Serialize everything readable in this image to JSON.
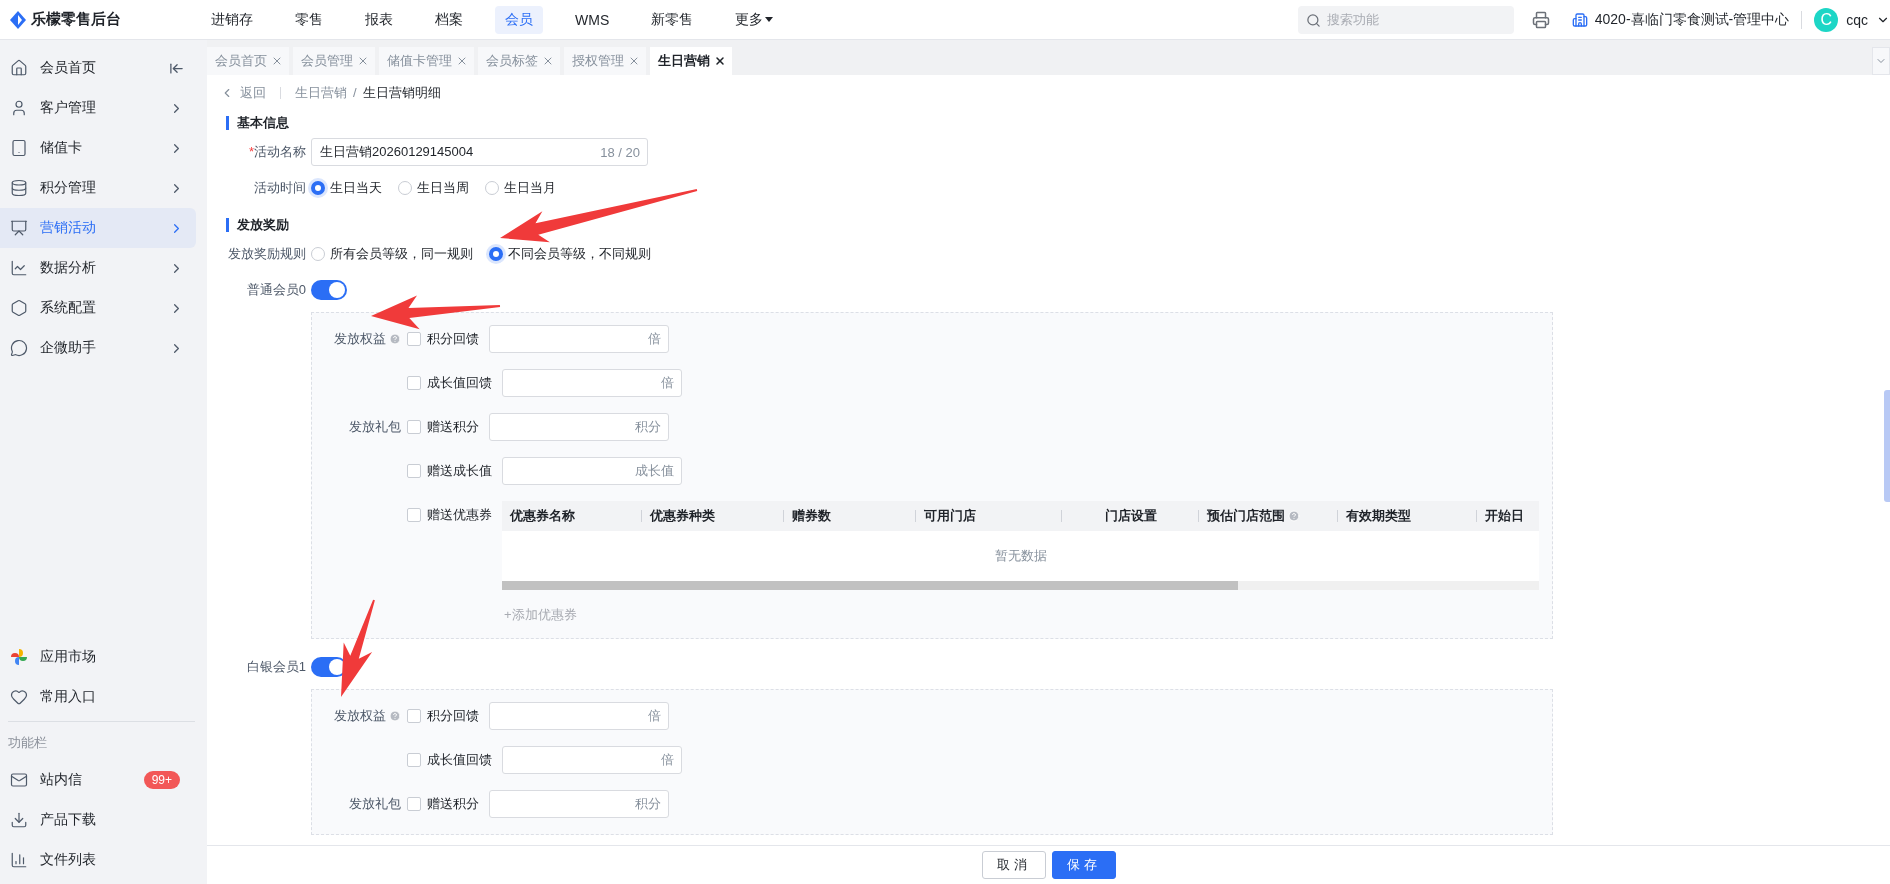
{
  "app": {
    "title": "乐檬零售后台"
  },
  "top_nav": [
    {
      "label": "进销存",
      "selected": false,
      "dropdown": false
    },
    {
      "label": "零售",
      "selected": false,
      "dropdown": false
    },
    {
      "label": "报表",
      "selected": false,
      "dropdown": false
    },
    {
      "label": "档案",
      "selected": false,
      "dropdown": false
    },
    {
      "label": "会员",
      "selected": true,
      "dropdown": false
    },
    {
      "label": "WMS",
      "selected": false,
      "dropdown": false
    },
    {
      "label": "新零售",
      "selected": false,
      "dropdown": false
    },
    {
      "label": "更多",
      "selected": false,
      "dropdown": true
    }
  ],
  "search": {
    "placeholder": "搜索功能"
  },
  "store": "4020-喜临门零食测试-管理中心",
  "user": {
    "initial": "C",
    "name": "cqc"
  },
  "sidebar": {
    "items": [
      {
        "label": "会员首页",
        "selected": false
      },
      {
        "label": "客户管理",
        "selected": false
      },
      {
        "label": "储值卡",
        "selected": false
      },
      {
        "label": "积分管理",
        "selected": false
      },
      {
        "label": "营销活动",
        "selected": true
      },
      {
        "label": "数据分析",
        "selected": false
      },
      {
        "label": "系统配置",
        "selected": false
      },
      {
        "label": "企微助手",
        "selected": false
      }
    ],
    "shortcuts": [
      {
        "label": "应用市场"
      },
      {
        "label": "常用入口"
      }
    ],
    "section_title": "功能栏",
    "tools": [
      {
        "label": "站内信",
        "badge": "99+"
      },
      {
        "label": "产品下载"
      },
      {
        "label": "文件列表"
      }
    ]
  },
  "tabs": [
    {
      "label": "会员首页",
      "selected": false
    },
    {
      "label": "会员管理",
      "selected": false
    },
    {
      "label": "储值卡管理",
      "selected": false
    },
    {
      "label": "会员标签",
      "selected": false
    },
    {
      "label": "授权管理",
      "selected": false
    },
    {
      "label": "生日营销",
      "selected": true
    }
  ],
  "breadcrumb": {
    "back": "返回",
    "separator": "/",
    "items": [
      "生日营销",
      "生日营销明细"
    ]
  },
  "basic": {
    "title": "基本信息",
    "name_field": {
      "label": "活动名称",
      "required_mark": "*",
      "value": "生日营销20260129145004",
      "counter": "18 / 20"
    },
    "time": {
      "label": "活动时间",
      "options": [
        {
          "label": "生日当天",
          "selected": true
        },
        {
          "label": "生日当周",
          "selected": false
        },
        {
          "label": "生日当月",
          "selected": false
        }
      ]
    }
  },
  "reward": {
    "title": "发放奖励",
    "rule": {
      "label": "发放奖励规则",
      "options": [
        {
          "label": "所有会员等级，同一规则",
          "selected": false
        },
        {
          "label": "不同会员等级，不同规则",
          "selected": true
        }
      ]
    },
    "levels": [
      {
        "name": "普通会员0",
        "on": true,
        "panel": {
          "rights_label": "发放权益",
          "rights_help": true,
          "rights": [
            {
              "label": "积分回馈",
              "checked": false,
              "unit": "倍"
            },
            {
              "label": "成长值回馈",
              "checked": false,
              "unit": "倍"
            }
          ],
          "gift_label": "发放礼包",
          "gifts": [
            {
              "kind": "input",
              "label": "赠送积分",
              "checked": false,
              "unit": "积分"
            },
            {
              "kind": "input",
              "label": "赠送成长值",
              "checked": false,
              "unit": "成长值"
            },
            {
              "kind": "coupons",
              "label": "赠送优惠券",
              "checked": false
            }
          ],
          "coupon_table": {
            "columns": [
              {
                "label": "优惠券名称",
                "help": false
              },
              {
                "label": "优惠券种类",
                "help": false
              },
              {
                "label": "赠券数",
                "help": false
              },
              {
                "label": "可用门店",
                "help": false
              },
              {
                "label": "门店设置",
                "help": false
              },
              {
                "label": "预估门店范围",
                "help": true
              },
              {
                "label": "有效期类型",
                "help": false
              },
              {
                "label": "开始日",
                "help": false
              }
            ],
            "empty": "暂无数据"
          },
          "add_link": "+添加优惠券"
        }
      },
      {
        "name": "白银会员1",
        "on": true,
        "panel": {
          "rights_label": "发放权益",
          "rights_help": true,
          "rights": [
            {
              "label": "积分回馈",
              "checked": false,
              "unit": "倍"
            },
            {
              "label": "成长值回馈",
              "checked": false,
              "unit": "倍"
            }
          ],
          "gift_label": "发放礼包",
          "gifts": [
            {
              "kind": "input",
              "label": "赠送积分",
              "checked": false,
              "unit": "积分"
            }
          ]
        }
      }
    ]
  },
  "footer": {
    "buttons": [
      {
        "label": "取消",
        "kind": "default"
      },
      {
        "label": "保存",
        "kind": "primary"
      }
    ]
  }
}
